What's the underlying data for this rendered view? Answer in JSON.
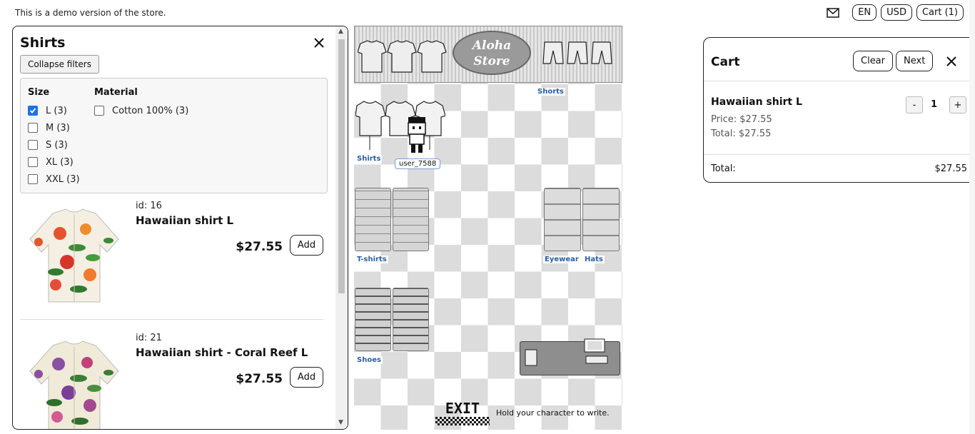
{
  "top": {
    "demo_note": "This is a demo version of the store.",
    "lang": "EN",
    "currency": "USD",
    "cart_label": "Cart (1)"
  },
  "panel": {
    "title": "Shirts",
    "collapse_label": "Collapse filters",
    "filters": {
      "size_heading": "Size",
      "sizes": [
        {
          "label": "L (3)",
          "checked": true
        },
        {
          "label": "M (3)",
          "checked": false
        },
        {
          "label": "S (3)",
          "checked": false
        },
        {
          "label": "XL (3)",
          "checked": false
        },
        {
          "label": "XXL (3)",
          "checked": false
        }
      ],
      "material_heading": "Material",
      "materials": [
        {
          "label": "Cotton 100% (3)",
          "checked": false
        }
      ]
    },
    "products": [
      {
        "id": "id: 16",
        "name": "Hawaiian shirt L",
        "price": "$27.55",
        "add_label": "Add"
      },
      {
        "id": "id: 21",
        "name": "Hawaiian shirt - Coral Reef L",
        "price": "$27.55",
        "add_label": "Add"
      }
    ]
  },
  "map": {
    "sign": "Aloha Store",
    "labels": {
      "shirts": "Shirts",
      "shorts": "Shorts",
      "tshirts": "T-shirts",
      "eyewear": "Eyewear",
      "hats": "Hats",
      "shoes": "Shoes"
    },
    "username": "user_7588",
    "exit": "EXIT",
    "hint": "Hold your character to write."
  },
  "cart": {
    "title": "Cart",
    "clear_label": "Clear",
    "next_label": "Next",
    "item_name": "Hawaiian shirt L",
    "item_price": "Price: $27.55",
    "item_total": "Total: $27.55",
    "qty": "1",
    "minus": "-",
    "plus": "+",
    "total_label": "Total:",
    "total_value": "$27.55"
  }
}
